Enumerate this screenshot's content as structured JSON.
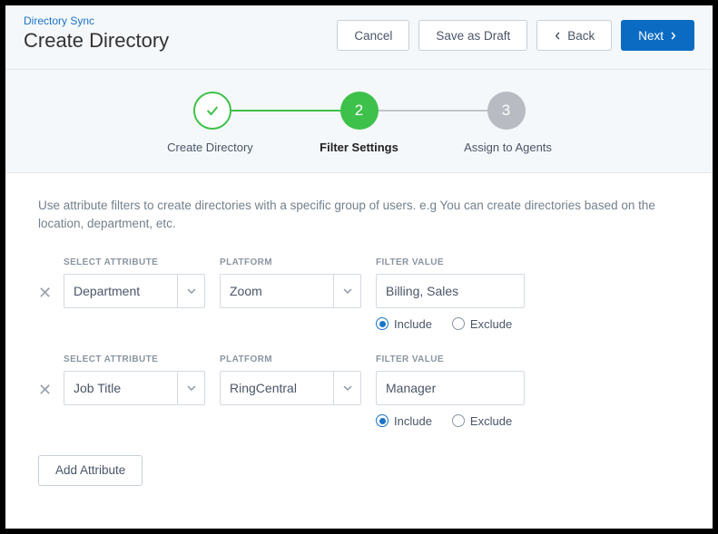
{
  "header": {
    "breadcrumb": "Directory Sync",
    "title": "Create Directory",
    "cancel": "Cancel",
    "saveDraft": "Save as Draft",
    "back": "Back",
    "next": "Next"
  },
  "steps": {
    "items": [
      {
        "num": "✓",
        "label": "Create Directory",
        "state": "done"
      },
      {
        "num": "2",
        "label": "Filter Settings",
        "state": "active"
      },
      {
        "num": "3",
        "label": "Assign to Agents",
        "state": "pending"
      }
    ]
  },
  "content": {
    "description": "Use attribute filters to create directories with a specific group of users. e.g You can create directories based on the location, department, etc.",
    "labels": {
      "attribute": "SELECT ATTRIBUTE",
      "platform": "PLATFORM",
      "filterValue": "FILTER VALUE",
      "include": "Include",
      "exclude": "Exclude",
      "addAttribute": "Add Attribute"
    },
    "filters": [
      {
        "attribute": "Department",
        "platform": "Zoom",
        "value": "Billing, Sales",
        "mode": "include"
      },
      {
        "attribute": "Job Title",
        "platform": "RingCentral",
        "value": "Manager",
        "mode": "include"
      }
    ]
  }
}
